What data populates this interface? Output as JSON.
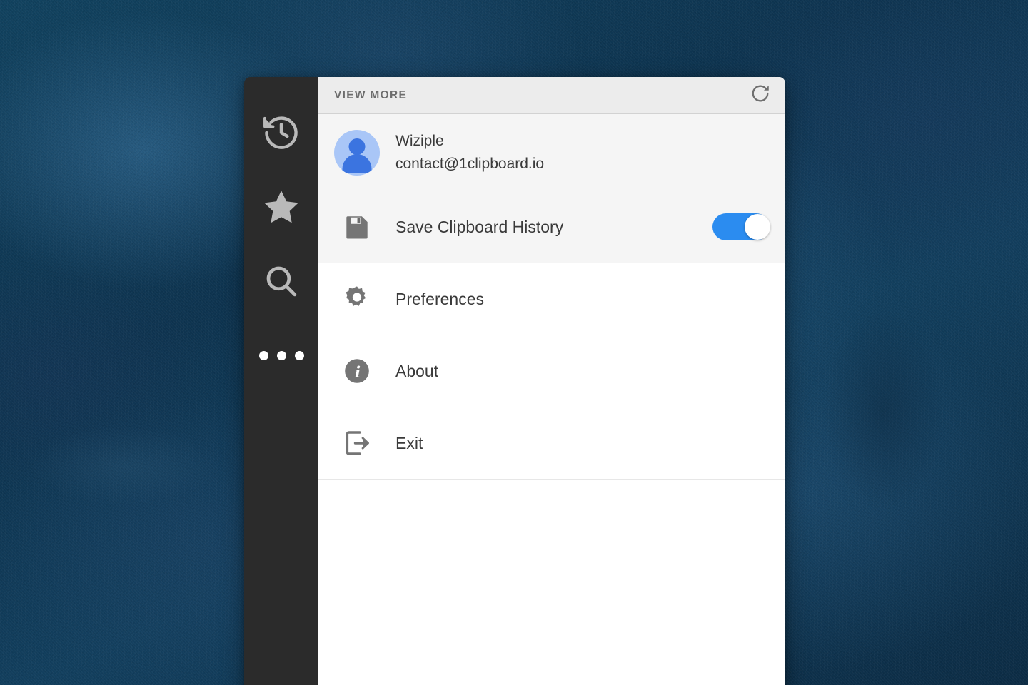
{
  "window": {
    "header": {
      "title": "VIEW MORE",
      "refresh_icon": "refresh-icon"
    }
  },
  "sidebar": {
    "items": [
      {
        "icon": "history-icon",
        "name": "history"
      },
      {
        "icon": "star-icon",
        "name": "favorites"
      },
      {
        "icon": "search-icon",
        "name": "search"
      },
      {
        "icon": "more-dots-icon",
        "name": "more",
        "active": true
      }
    ]
  },
  "account": {
    "name": "Wiziple",
    "email": "contact@1clipboard.io",
    "avatar_icon": "user-avatar-icon"
  },
  "menu": {
    "items": [
      {
        "label": "Save Clipboard History",
        "icon": "floppy-disk-icon",
        "control": "toggle",
        "toggle_state": "on"
      },
      {
        "label": "Preferences",
        "icon": "gear-icon",
        "control": "none"
      },
      {
        "label": "About",
        "icon": "info-icon",
        "control": "none"
      },
      {
        "label": "Exit",
        "icon": "logout-icon",
        "control": "none"
      }
    ]
  },
  "colors": {
    "accent": "#2b8cf0",
    "sidebar_bg": "#2b2b2b",
    "header_bg": "#ececec",
    "row_shaded_bg": "#f5f5f5",
    "panel_bg": "#ffffff",
    "text": "#3a3a3a",
    "icon_gray": "#757575",
    "avatar_bg": "#a9c6f7",
    "avatar_fg": "#3b74e0",
    "desktop_bg": "#11425f"
  }
}
